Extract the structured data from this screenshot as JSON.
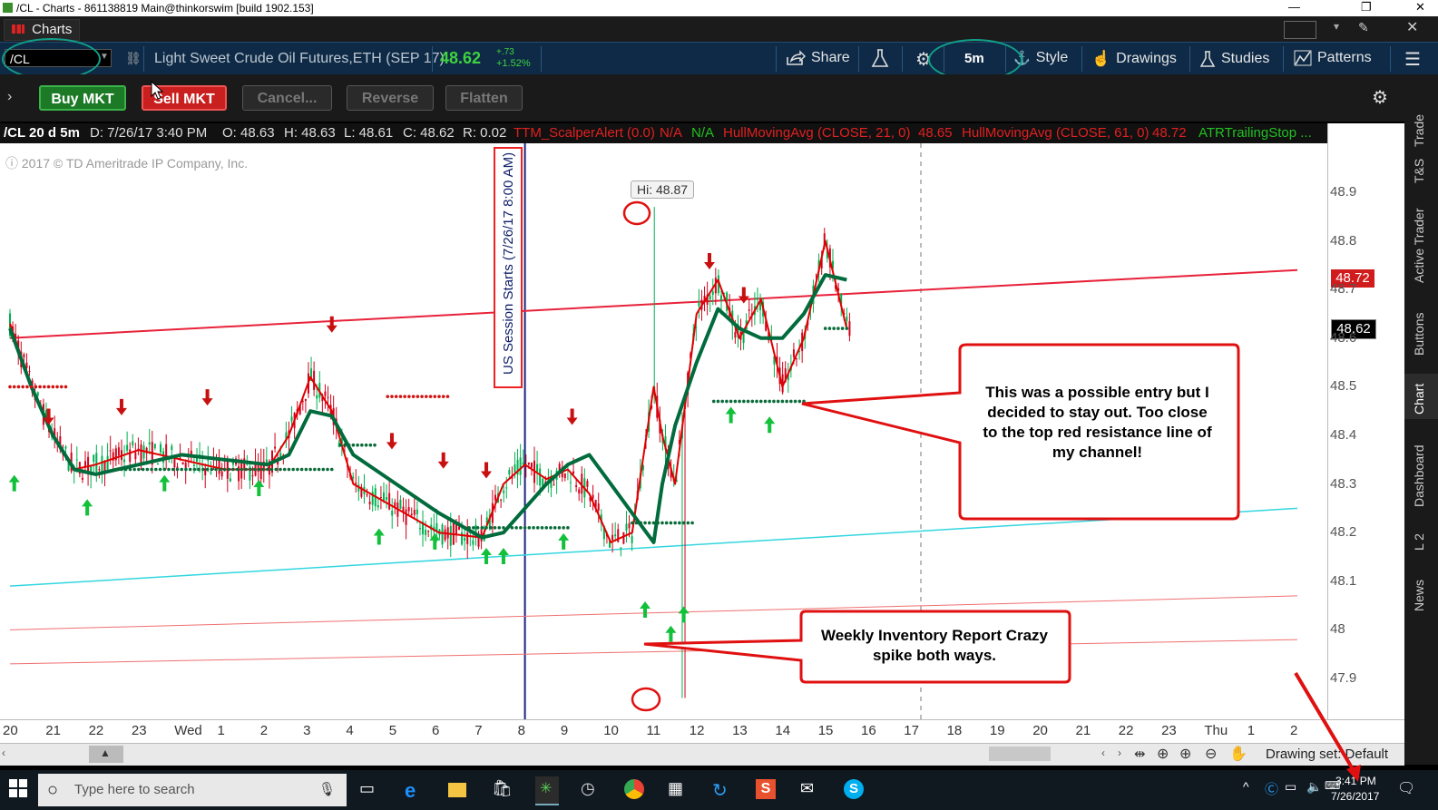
{
  "window": {
    "title": "/CL - Charts - 861138819 Main@thinkorswim [build 1902.153]",
    "controls": [
      "—",
      "❐",
      "✕"
    ]
  },
  "tab": {
    "label": "Charts"
  },
  "symbol_bar": {
    "symbol": "/CL",
    "description": "Light Sweet Crude Oil Futures,ETH (SEP 17)",
    "last": "48.62",
    "change": "+.73",
    "change_pct": "+1.52%",
    "share_label": "Share",
    "interval_label": "5m",
    "style_label": "Style",
    "drawings_label": "Drawings",
    "studies_label": "Studies",
    "patterns_label": "Patterns"
  },
  "order_bar": {
    "buy": "Buy MKT",
    "sell": "Sell MKT",
    "cancel": "Cancel...",
    "reverse": "Reverse",
    "flatten": "Flatten"
  },
  "study_header": {
    "symbol": "/CL 20 d 5m",
    "date": "D: 7/26/17 3:40 PM",
    "open": "O: 48.63",
    "high": "H: 48.63",
    "low": "L: 48.61",
    "close": "C: 48.62",
    "range": "R: 0.02",
    "scalper": "TTM_ScalperAlert (0.0)",
    "na1": "N/A",
    "na2": "N/A",
    "hull21": "HullMovingAvg (CLOSE, 21, 0)",
    "hull21_val": "48.65",
    "hull61": "HullMovingAvg (CLOSE, 61, 0)",
    "hull61_val": "48.72",
    "atr": "ATRTrailingStop ..."
  },
  "chart": {
    "copyright": "2017 © TD Ameritrade IP Company, Inc.",
    "session_label": "US Session Starts (7/26/17 8:00 AM)",
    "hi_label": "Hi: 48.87",
    "price_badge_red": "48.72",
    "price_badge_last": "48.62",
    "callout_entry": "This was a possible entry but I decided to stay out. Too close to the top red resistance line of my channel!",
    "callout_inventory": "Weekly Inventory Report Crazy spike both ways.",
    "colors": {
      "up": "#00b050",
      "down": "#d0021b",
      "hull_fast": "#e00000",
      "hull_slow": "#006b3c",
      "resistance": "#e8223a",
      "support": "#33d6e0"
    }
  },
  "chart_data": {
    "type": "line",
    "price_ticks": [
      "48.9",
      "48.8",
      "48.7",
      "48.6",
      "48.5",
      "48.4",
      "48.3",
      "48.2",
      "48.1",
      "48",
      "47.9"
    ],
    "time_ticks": [
      "20",
      "21",
      "22",
      "23",
      "Wed",
      "1",
      "2",
      "3",
      "4",
      "5",
      "6",
      "7",
      "8",
      "9",
      "10",
      "11",
      "12",
      "13",
      "14",
      "15",
      "16",
      "17",
      "18",
      "19",
      "20",
      "21",
      "22",
      "23",
      "Thu",
      "1",
      "2"
    ],
    "ylim": [
      47.84,
      48.96
    ],
    "hull_slow": [
      [
        0,
        48.62
      ],
      [
        0.5,
        48.5
      ],
      [
        1,
        48.4
      ],
      [
        1.5,
        48.33
      ],
      [
        2,
        48.32
      ],
      [
        3,
        48.34
      ],
      [
        4,
        48.36
      ],
      [
        5,
        48.35
      ],
      [
        6,
        48.34
      ],
      [
        6.5,
        48.36
      ],
      [
        7,
        48.45
      ],
      [
        7.5,
        48.44
      ],
      [
        8,
        48.36
      ],
      [
        9,
        48.3
      ],
      [
        10,
        48.24
      ],
      [
        11,
        48.19
      ],
      [
        11.5,
        48.2
      ],
      [
        12,
        48.25
      ],
      [
        12.5,
        48.3
      ],
      [
        13,
        48.34
      ],
      [
        13.5,
        48.36
      ],
      [
        14,
        48.3
      ],
      [
        14.5,
        48.24
      ],
      [
        15,
        48.18
      ],
      [
        15.2,
        48.3
      ],
      [
        15.5,
        48.42
      ],
      [
        16,
        48.55
      ],
      [
        16.5,
        48.66
      ],
      [
        17,
        48.62
      ],
      [
        17.5,
        48.6
      ],
      [
        18,
        48.6
      ],
      [
        18.5,
        48.65
      ],
      [
        19,
        48.73
      ],
      [
        19.5,
        48.72
      ]
    ],
    "hull_fast": [
      [
        0,
        48.63
      ],
      [
        0.5,
        48.5
      ],
      [
        1,
        48.4
      ],
      [
        1.5,
        48.33
      ],
      [
        2,
        48.34
      ],
      [
        3,
        48.37
      ],
      [
        4,
        48.35
      ],
      [
        5,
        48.33
      ],
      [
        6,
        48.33
      ],
      [
        6.5,
        48.4
      ],
      [
        7,
        48.52
      ],
      [
        7.5,
        48.45
      ],
      [
        8,
        48.3
      ],
      [
        9,
        48.25
      ],
      [
        10,
        48.2
      ],
      [
        11,
        48.19
      ],
      [
        11.5,
        48.3
      ],
      [
        12,
        48.34
      ],
      [
        12.5,
        48.31
      ],
      [
        13,
        48.33
      ],
      [
        13.5,
        48.28
      ],
      [
        14,
        48.18
      ],
      [
        14.5,
        48.2
      ],
      [
        15,
        48.5
      ],
      [
        15.2,
        48.4
      ],
      [
        15.5,
        48.3
      ],
      [
        16,
        48.65
      ],
      [
        16.5,
        48.72
      ],
      [
        17,
        48.6
      ],
      [
        17.5,
        48.68
      ],
      [
        18,
        48.5
      ],
      [
        18.5,
        48.6
      ],
      [
        19,
        48.8
      ],
      [
        19.5,
        48.62
      ]
    ],
    "resistance": [
      [
        0,
        48.6
      ],
      [
        30,
        48.74
      ]
    ],
    "support_cyan": [
      [
        0,
        48.09
      ],
      [
        30,
        48.25
      ]
    ],
    "support_red1": [
      [
        0,
        48.0
      ],
      [
        30,
        48.07
      ]
    ],
    "support_red2": [
      [
        0,
        47.93
      ],
      [
        30,
        47.98
      ]
    ]
  },
  "bottom_bar": {
    "drawing_set": "Drawing set: Default"
  },
  "sidebar_tabs": [
    "Trade",
    "T&S",
    "Active Trader",
    "Buttons",
    "Chart",
    "Dashboard",
    "L 2",
    "News"
  ],
  "taskbar": {
    "search_placeholder": "Type here to search",
    "time": "3:41 PM",
    "date": "7/26/2017"
  }
}
